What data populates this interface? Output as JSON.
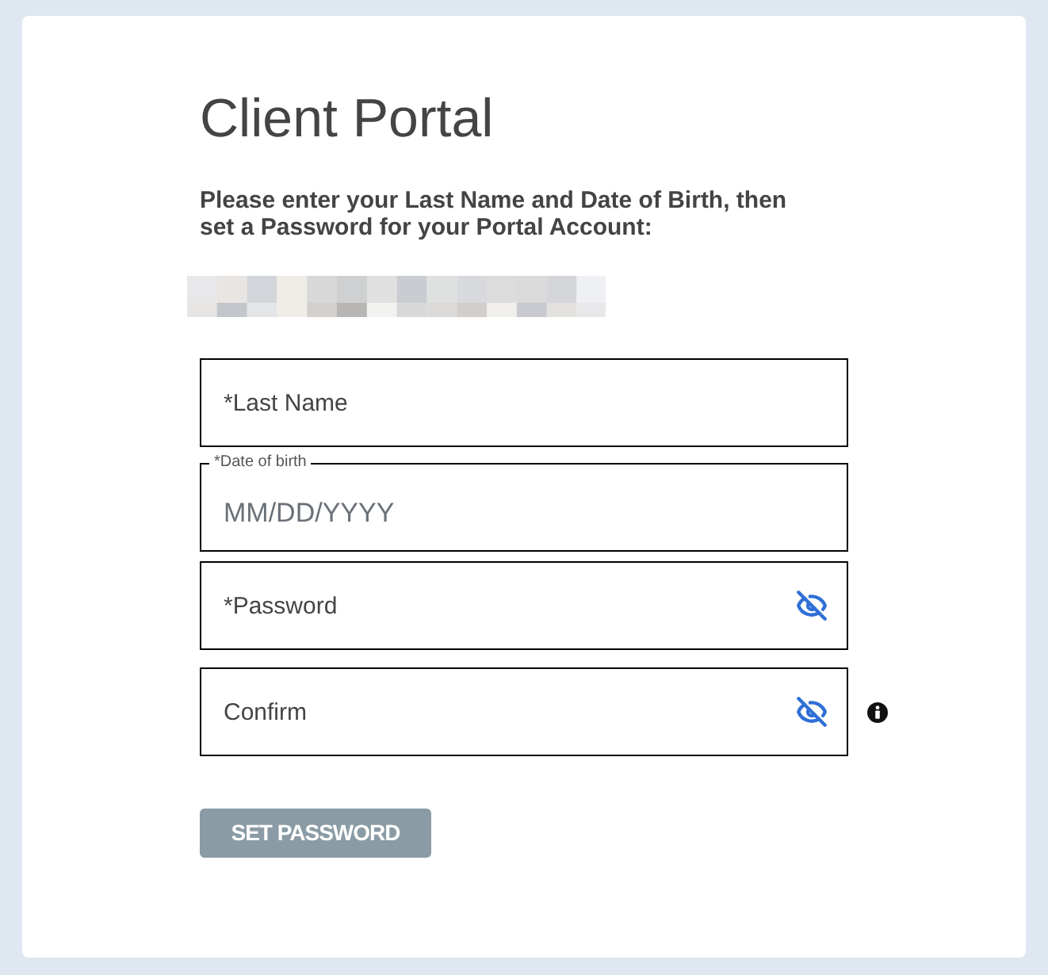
{
  "title": "Client Portal",
  "instructions": "Please enter your Last Name and Date of Birth, then set a Password for your Portal Account:",
  "fields": [
    {
      "kind": "text",
      "placeholder": "*Last Name"
    },
    {
      "kind": "date",
      "legend": "*Date of birth",
      "placeholder": "MM/DD/YYYY"
    },
    {
      "kind": "password",
      "placeholder": "*Password",
      "masked": true
    },
    {
      "kind": "password",
      "placeholder": "Confirm",
      "masked": true,
      "info": true
    }
  ],
  "button": {
    "label": "SET PASSWORD",
    "disabled": true
  }
}
